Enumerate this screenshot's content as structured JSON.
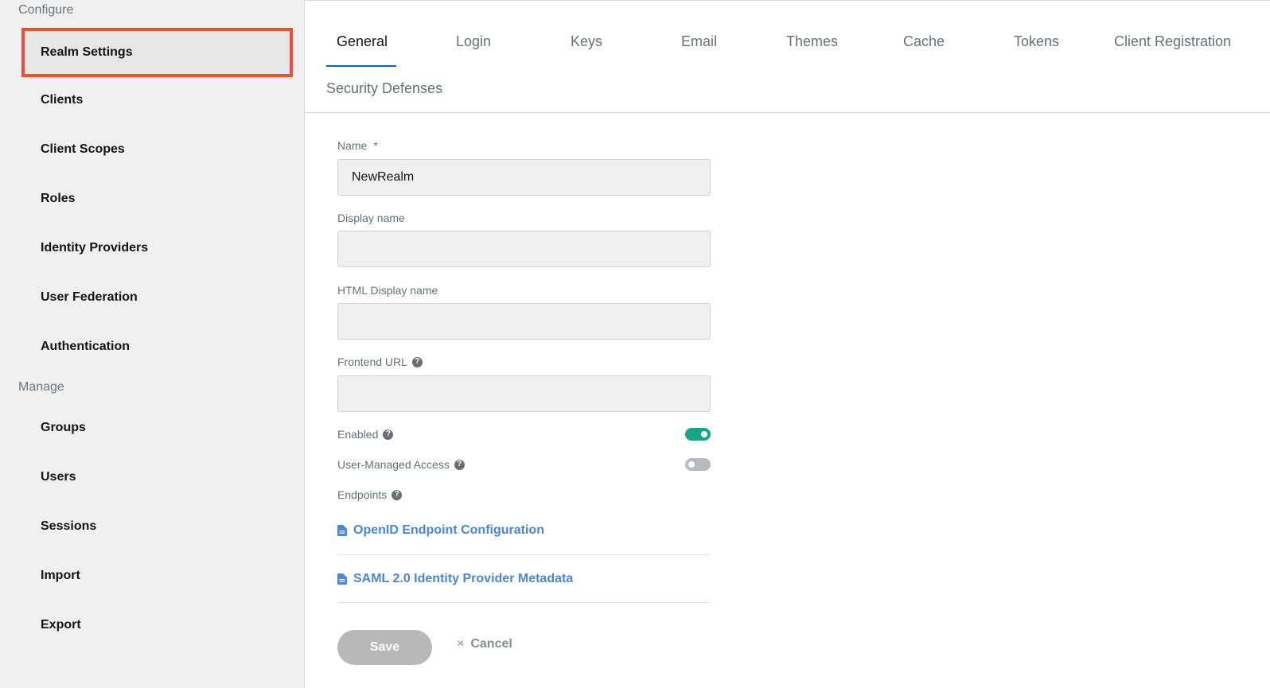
{
  "sidebar": {
    "configure_title": "Configure",
    "configure_items": [
      {
        "label": "Realm Settings",
        "active": true
      },
      {
        "label": "Clients"
      },
      {
        "label": "Client Scopes"
      },
      {
        "label": "Roles"
      },
      {
        "label": "Identity Providers"
      },
      {
        "label": "User Federation"
      },
      {
        "label": "Authentication"
      }
    ],
    "manage_title": "Manage",
    "manage_items": [
      {
        "label": "Groups"
      },
      {
        "label": "Users"
      },
      {
        "label": "Sessions"
      },
      {
        "label": "Import"
      },
      {
        "label": "Export"
      }
    ]
  },
  "tabs": [
    {
      "label": "General",
      "active": true
    },
    {
      "label": "Login"
    },
    {
      "label": "Keys"
    },
    {
      "label": "Email"
    },
    {
      "label": "Themes"
    },
    {
      "label": "Cache"
    },
    {
      "label": "Tokens"
    },
    {
      "label": "Client Registration"
    },
    {
      "label": "Security Defenses"
    }
  ],
  "form": {
    "name_label": "Name",
    "name_required": "*",
    "name_value": "NewRealm",
    "display_name_label": "Display name",
    "display_name_value": "",
    "html_display_name_label": "HTML Display name",
    "html_display_name_value": "",
    "frontend_url_label": "Frontend URL",
    "frontend_url_value": "",
    "enabled_label": "Enabled",
    "enabled": true,
    "user_managed_access_label": "User-Managed Access",
    "user_managed_access": false,
    "endpoints_label": "Endpoints",
    "endpoints": [
      {
        "label": "OpenID Endpoint Configuration"
      },
      {
        "label": "SAML 2.0 Identity Provider Metadata"
      }
    ],
    "help_glyph": "?"
  },
  "actions": {
    "save_label": "Save",
    "cancel_label": "Cancel",
    "cancel_glyph": "×"
  },
  "colors": {
    "accent": "#0066cc",
    "link": "#4a86d8",
    "toggle_on": "#17a589",
    "highlight_border": "#ef4e34"
  }
}
